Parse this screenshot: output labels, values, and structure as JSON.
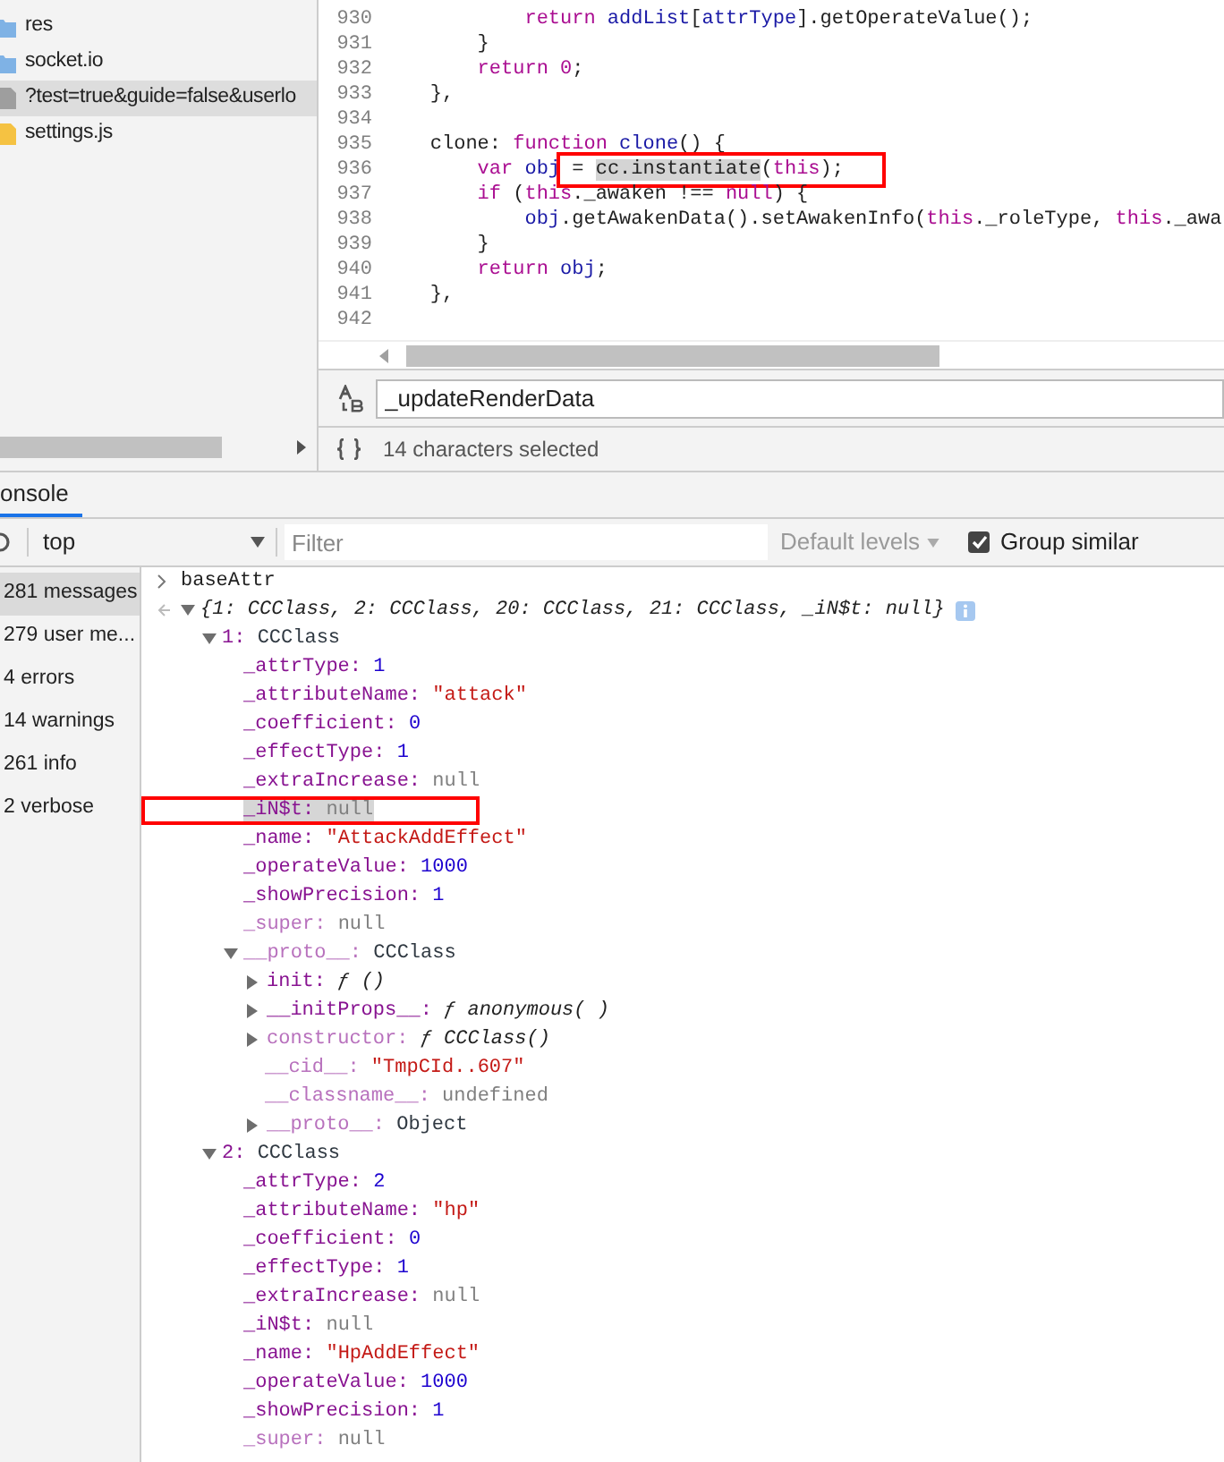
{
  "file_tree": {
    "items": [
      {
        "name": "res",
        "kind": "folder",
        "selected": false
      },
      {
        "name": "socket.io",
        "kind": "folder",
        "selected": false
      },
      {
        "name": "?test=true&guide=false&userlo",
        "kind": "file",
        "selected": true
      },
      {
        "name": "settings.js",
        "kind": "script",
        "selected": false
      }
    ]
  },
  "editor": {
    "lines": [
      {
        "number": "930",
        "segments": [
          {
            "text": "            return",
            "kind": "keyword"
          },
          {
            "text": " addList",
            "kind": "variable"
          },
          {
            "text": "["
          },
          {
            "text": "attrType",
            "kind": "variable"
          },
          {
            "text": "].getOperateValue();"
          }
        ]
      },
      {
        "number": "931",
        "segments": [
          {
            "text": "        }"
          }
        ]
      },
      {
        "number": "932",
        "segments": [
          {
            "text": "        return",
            "kind": "keyword"
          },
          {
            "text": " 0",
            "kind": "number"
          },
          {
            "text": ";"
          }
        ]
      },
      {
        "number": "933",
        "segments": [
          {
            "text": "    },"
          }
        ]
      },
      {
        "number": "934"
      },
      {
        "number": "935",
        "segments": [
          {
            "text": "    clone: "
          },
          {
            "text": "function",
            "kind": "keyword"
          },
          {
            "text": " clone",
            "kind": "variable"
          },
          {
            "text": "() {"
          }
        ]
      },
      {
        "number": "936",
        "segments": [
          {
            "text": "        var",
            "kind": "keyword"
          },
          {
            "text": " obj",
            "kind": "variable"
          },
          {
            "text": " = ",
            "boxed": true
          },
          {
            "text": "cc.instantiate",
            "boxed": true,
            "selected": true
          },
          {
            "text": "(",
            "boxed": true
          },
          {
            "text": "this",
            "kind": "keyword",
            "boxed": true
          },
          {
            "text": ");",
            "boxed": true
          }
        ]
      },
      {
        "number": "937",
        "segments": [
          {
            "text": "        if",
            "kind": "keyword"
          },
          {
            "text": " ("
          },
          {
            "text": "this",
            "kind": "keyword"
          },
          {
            "text": "._awaken !== "
          },
          {
            "text": "null",
            "kind": "keyword"
          },
          {
            "text": ") {"
          }
        ]
      },
      {
        "number": "938",
        "segments": [
          {
            "text": "            obj",
            "kind": "variable"
          },
          {
            "text": ".getAwakenData().setAwakenInfo("
          },
          {
            "text": "this",
            "kind": "keyword"
          },
          {
            "text": "._roleType, "
          },
          {
            "text": "this",
            "kind": "keyword"
          },
          {
            "text": "._awa"
          }
        ]
      },
      {
        "number": "939",
        "segments": [
          {
            "text": "        }"
          }
        ]
      },
      {
        "number": "940",
        "segments": [
          {
            "text": "        return",
            "kind": "keyword"
          },
          {
            "text": " obj",
            "kind": "variable"
          },
          {
            "text": ";"
          }
        ]
      },
      {
        "number": "941",
        "segments": [
          {
            "text": "    },"
          }
        ]
      },
      {
        "number": "942"
      }
    ]
  },
  "search_bar": {
    "value": "_updateRenderData"
  },
  "status_bar": {
    "text": "14 characters selected"
  },
  "drawer": {
    "tabs": [
      {
        "label": "onsole",
        "selected": true
      }
    ]
  },
  "console_toolbar": {
    "context": "top",
    "filter_placeholder": "Filter",
    "levels": "Default levels",
    "group_similar": {
      "label": "Group similar",
      "checked": true
    }
  },
  "console_sidebar": {
    "items": [
      {
        "label": "281 messages",
        "selected": true
      },
      {
        "label": "279 user me...",
        "selected": false
      },
      {
        "label": "4 errors",
        "selected": false
      },
      {
        "label": "14 warnings",
        "selected": false
      },
      {
        "label": "261 info",
        "selected": false
      },
      {
        "label": "2 verbose",
        "selected": false
      }
    ]
  },
  "console": {
    "input": "baseAttr",
    "result": {
      "summary": "{1: CCClass, 2: CCClass, 20: CCClass, 21: CCClass, _iN$t: null}",
      "expanded": true,
      "children": [
        {
          "key": "1:",
          "value": "CCClass",
          "kind": "class",
          "expanded": true,
          "children": [
            {
              "key": "_attrType:",
              "value": "1",
              "kind": "number"
            },
            {
              "key": "_attributeName:",
              "value": "\"attack\"",
              "kind": "string"
            },
            {
              "key": "_coefficient:",
              "value": "0",
              "kind": "number"
            },
            {
              "key": "_effectType:",
              "value": "1",
              "kind": "number"
            },
            {
              "key": "_extraIncrease:",
              "value": "null",
              "kind": "null"
            },
            {
              "key": "_iN$t:",
              "value": "null",
              "kind": "null",
              "highlighted": true
            },
            {
              "key": "_name:",
              "value": "\"AttackAddEffect\"",
              "kind": "string"
            },
            {
              "key": "_operateValue:",
              "value": "1000",
              "kind": "number"
            },
            {
              "key": "_showPrecision:",
              "value": "1",
              "kind": "number"
            },
            {
              "key": "_super:",
              "value": "null",
              "kind": "null",
              "dim": true
            },
            {
              "key": "__proto__:",
              "value": "CCClass",
              "kind": "class",
              "dim": true,
              "expanded": true,
              "children": [
                {
                  "key": "init:",
                  "value": "ƒ ()",
                  "kind": "function",
                  "expanded": false
                },
                {
                  "key": "__initProps__:",
                  "value": "ƒ anonymous( )",
                  "kind": "function",
                  "expanded": false
                },
                {
                  "key": "constructor:",
                  "value": "ƒ CCClass()",
                  "kind": "function",
                  "dim": true,
                  "expanded": false
                },
                {
                  "key": "__cid__:",
                  "value": "\"TmpCId..607\"",
                  "kind": "string",
                  "dim": true
                },
                {
                  "key": "__classname__:",
                  "value": "undefined",
                  "kind": "null",
                  "dim": true
                },
                {
                  "key": "__proto__:",
                  "value": "Object",
                  "kind": "class",
                  "dim": true,
                  "expanded": false
                }
              ]
            }
          ]
        },
        {
          "key": "2:",
          "value": "CCClass",
          "kind": "class",
          "expanded": true,
          "children": [
            {
              "key": "_attrType:",
              "value": "2",
              "kind": "number"
            },
            {
              "key": "_attributeName:",
              "value": "\"hp\"",
              "kind": "string"
            },
            {
              "key": "_coefficient:",
              "value": "0",
              "kind": "number"
            },
            {
              "key": "_effectType:",
              "value": "1",
              "kind": "number"
            },
            {
              "key": "_extraIncrease:",
              "value": "null",
              "kind": "null"
            },
            {
              "key": "_iN$t:",
              "value": "null",
              "kind": "null"
            },
            {
              "key": "_name:",
              "value": "\"HpAddEffect\"",
              "kind": "string"
            },
            {
              "key": "_operateValue:",
              "value": "1000",
              "kind": "number"
            },
            {
              "key": "_showPrecision:",
              "value": "1",
              "kind": "number"
            },
            {
              "key": "_super:",
              "value": "null",
              "kind": "null",
              "dim": true
            }
          ]
        }
      ]
    }
  }
}
